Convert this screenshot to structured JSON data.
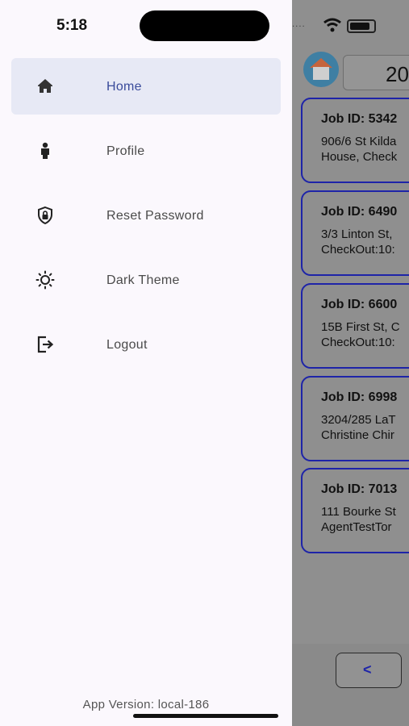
{
  "status_bar": {
    "time": "5:18"
  },
  "menu": {
    "items": [
      {
        "label": "Home",
        "icon": "home-icon",
        "active": true
      },
      {
        "label": "Profile",
        "icon": "person-icon",
        "active": false
      },
      {
        "label": "Reset Password",
        "icon": "shield-lock-icon",
        "active": false
      },
      {
        "label": "Dark Theme",
        "icon": "brightness-icon",
        "active": false
      },
      {
        "label": "Logout",
        "icon": "logout-icon",
        "active": false
      }
    ]
  },
  "footer": {
    "version": "App Version: local-186"
  },
  "background": {
    "search_value": "20",
    "jobs": [
      {
        "id": "Job ID: 5342",
        "line1": "906/6 St Kilda",
        "line2": "House, Check"
      },
      {
        "id": "Job ID: 6490",
        "line1": "3/3 Linton St,",
        "line2": "CheckOut:10:"
      },
      {
        "id": "Job ID: 6600",
        "line1": "15B First St, C",
        "line2": "CheckOut:10:"
      },
      {
        "id": "Job ID: 6998",
        "line1": "3204/285 LaT",
        "line2": "Christine Chir"
      },
      {
        "id": "Job ID: 7013",
        "line1": "111 Bourke St",
        "line2": "AgentTestTor"
      }
    ],
    "back_label": "<"
  },
  "colors": {
    "accent": "#3a4b9b",
    "card_border": "#1e24a8",
    "active_bg": "#e7e9f5"
  }
}
